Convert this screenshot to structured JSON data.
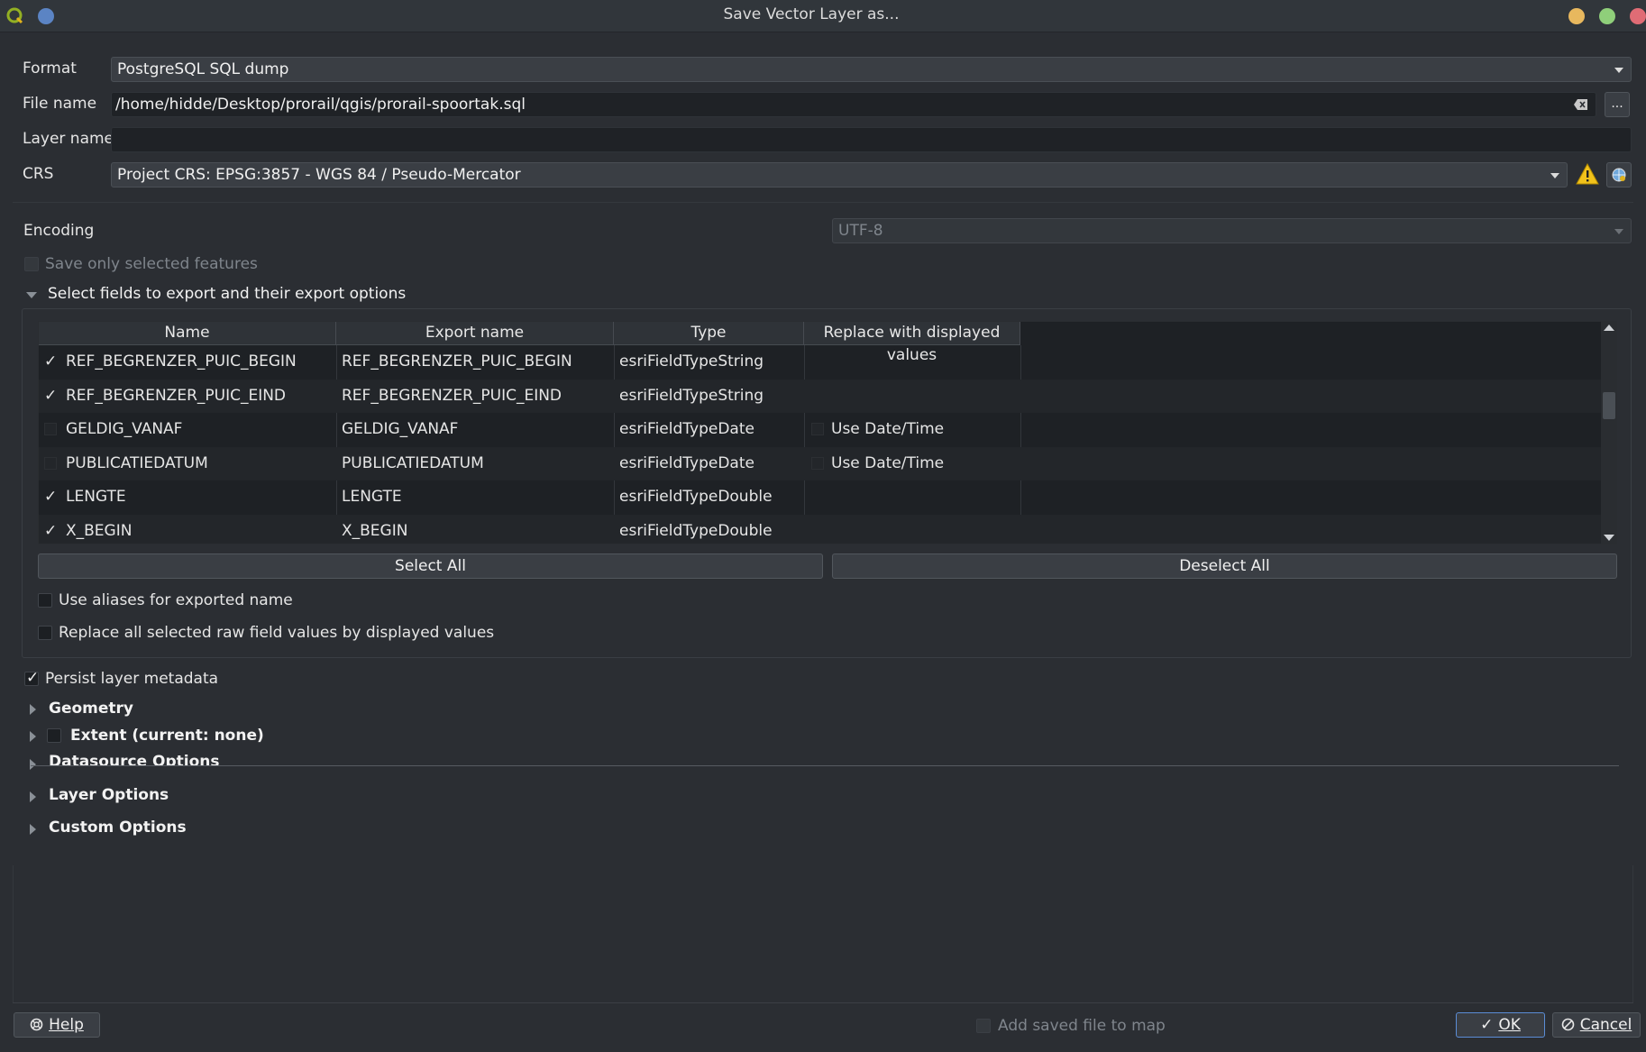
{
  "window": {
    "title": "Save Vector Layer as...",
    "traffic_colors": [
      "#e8b85e",
      "#8fcf7a",
      "#e06c75"
    ]
  },
  "form": {
    "format_label": "Format",
    "format_value": "PostgreSQL SQL dump",
    "filename_label": "File name",
    "filename_value": "/home/hidde/Desktop/prorail/qgis/prorail-spoortak.sql",
    "browse_label": "...",
    "layername_label": "Layer name",
    "layername_value": "",
    "crs_label": "CRS",
    "crs_value": "Project CRS: EPSG:3857 - WGS 84 / Pseudo-Mercator",
    "encoding_label": "Encoding",
    "encoding_value": "UTF-8",
    "save_selected_label": "Save only selected features"
  },
  "fields_section": {
    "title": "Select fields to export and their export options",
    "columns": [
      "Name",
      "Export name",
      "Type",
      "Replace with displayed values"
    ],
    "rows": [
      {
        "checked": true,
        "name": "REF_BEGRENZER_PUIC_BEGIN",
        "export": "REF_BEGRENZER_PUIC_BEGIN",
        "type": "esriFieldTypeString",
        "replace": ""
      },
      {
        "checked": true,
        "name": "REF_BEGRENZER_PUIC_EIND",
        "export": "REF_BEGRENZER_PUIC_EIND",
        "type": "esriFieldTypeString",
        "replace": ""
      },
      {
        "checked": false,
        "name": "GELDIG_VANAF",
        "export": "GELDIG_VANAF",
        "type": "esriFieldTypeDate",
        "replace": "Use Date/Time"
      },
      {
        "checked": false,
        "name": "PUBLICATIEDATUM",
        "export": "PUBLICATIEDATUM",
        "type": "esriFieldTypeDate",
        "replace": "Use Date/Time"
      },
      {
        "checked": true,
        "name": "LENGTE",
        "export": "LENGTE",
        "type": "esriFieldTypeDouble",
        "replace": ""
      },
      {
        "checked": true,
        "name": "X_BEGIN",
        "export": "X_BEGIN",
        "type": "esriFieldTypeDouble",
        "replace": ""
      }
    ],
    "select_all": "Select All",
    "deselect_all": "Deselect All",
    "use_aliases": "Use aliases for exported name",
    "replace_all": "Replace all selected raw field values by displayed values"
  },
  "persist_metadata": "Persist layer metadata",
  "sections": {
    "geometry": "Geometry",
    "extent": "Extent (current: none)",
    "datasource": "Datasource Options",
    "layer": "Layer Options",
    "custom": "Custom Options"
  },
  "footer": {
    "help": "Help",
    "add_to_map": "Add saved file to map",
    "ok": "OK",
    "cancel": "Cancel"
  }
}
